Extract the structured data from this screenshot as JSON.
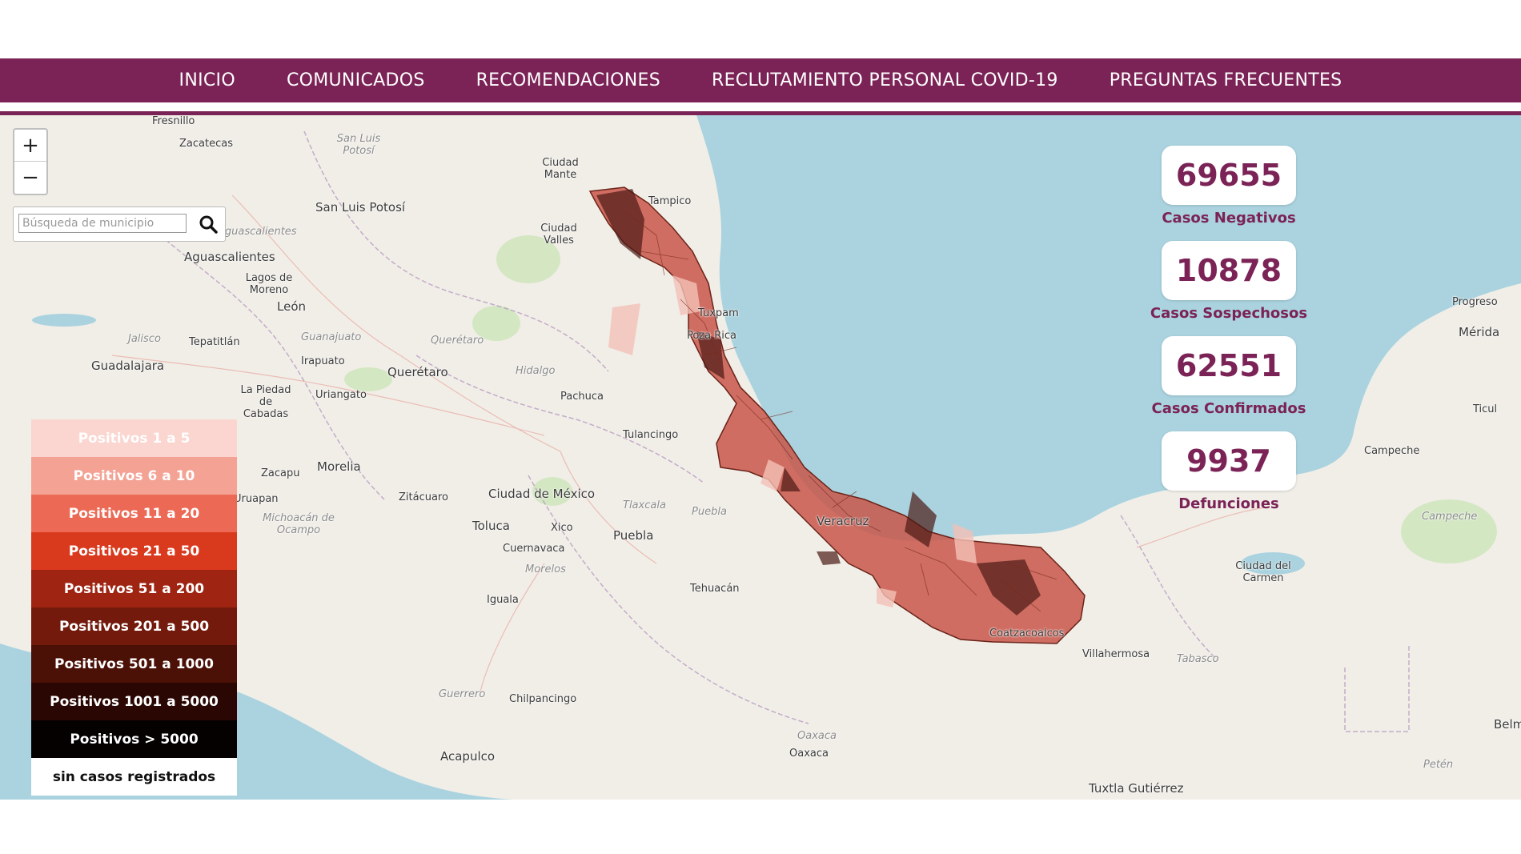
{
  "nav": {
    "items": [
      {
        "label": "INICIO"
      },
      {
        "label": "COMUNICADOS"
      },
      {
        "label": "RECOMENDACIONES"
      },
      {
        "label": "RECLUTAMIENTO PERSONAL COVID-19"
      },
      {
        "label": "PREGUNTAS FRECUENTES"
      }
    ]
  },
  "colors": {
    "brand": "#7b2356",
    "water": "#aad3df",
    "land": "#f1eee8"
  },
  "map": {
    "zoom_in": "+",
    "zoom_out": "−",
    "search_placeholder": "Búsqueda de municipio",
    "search_icon": "search-icon",
    "places": {
      "fresnillo": "Fresnillo",
      "zacatecas": "Zacatecas",
      "san_luis_potosi_state": "San Luis Potosí",
      "san_luis_potosi": "San Luis Potosí",
      "ciudad_mante": "Ciudad Mante",
      "tampico": "Tampico",
      "aguascalientes_state": "Aguascalientes",
      "aguascalientes": "Aguascalientes",
      "ciudad_valles": "Ciudad Valles",
      "lagos_de_moreno": "Lagos de Moreno",
      "leon": "León",
      "jalisco": "Jalisco",
      "tepatitlan": "Tepatitlán",
      "guanajuato": "Guanajuato",
      "queretaro_state": "Querétaro",
      "irapuato": "Irapuato",
      "guadalajara": "Guadalajara",
      "queretaro": "Querétaro",
      "hidalgo": "Hidalgo",
      "uriangato": "Uriangato",
      "pachuca": "Pachuca",
      "la_piedad": "La Piedad de Cabadas",
      "tulancingo": "Tulancingo",
      "morelia": "Morelia",
      "zacapu": "Zacapu",
      "uruapan": "Uruapan",
      "zitacuaro": "Zitácuaro",
      "ciudad_de_mexico": "Ciudad de México",
      "tlaxcala": "Tlaxcala",
      "michoacan": "Michoacán de Ocampo",
      "toluca": "Toluca",
      "xico": "Xico",
      "puebla": "Puebla",
      "puebla_state": "Puebla",
      "cuernavaca": "Cuernavaca",
      "morelos": "Morelos",
      "tehuacan": "Tehuacán",
      "iguala": "Iguala",
      "guerrero": "Guerrero",
      "chilpancingo": "Chilpancingo",
      "oaxaca_state": "Oaxaca",
      "oaxaca": "Oaxaca",
      "acapulco": "Acapulco",
      "veracruz": "Veracruz",
      "poza_rica": "Poza Rica",
      "tuxpam": "Tuxpam",
      "coatzacoalcos": "Coatzacoalcos",
      "villahermosa": "Villahermosa",
      "tabasco": "Tabasco",
      "ciudad_del_carmen": "Ciudad del Carmen",
      "campeche_city": "Campeche",
      "campeche_state": "Campeche",
      "progreso": "Progreso",
      "merida": "Mérida",
      "ticul": "Ticul",
      "tuxtla": "Tuxtla Gutiérrez",
      "peten": "Petén",
      "belmopan": "Belm"
    }
  },
  "legend": [
    {
      "label": "Positivos 1 a 5",
      "color": "#fbd5cf",
      "text_color": "#ffffff"
    },
    {
      "label": "Positivos 6 a 10",
      "color": "#f3a294",
      "text_color": "#ffffff"
    },
    {
      "label": "Positivos 11 a 20",
      "color": "#ec6a55",
      "text_color": "#ffffff"
    },
    {
      "label": "Positivos 21 a 50",
      "color": "#d9391d",
      "text_color": "#ffffff"
    },
    {
      "label": "Positivos 51 a 200",
      "color": "#9f2412",
      "text_color": "#ffffff"
    },
    {
      "label": "Positivos 201 a 500",
      "color": "#731a0c",
      "text_color": "#ffffff"
    },
    {
      "label": "Positivos 501 a 1000",
      "color": "#4b1006",
      "text_color": "#ffffff"
    },
    {
      "label": "Positivos 1001 a 5000",
      "color": "#2a0702",
      "text_color": "#ffffff"
    },
    {
      "label": "Positivos > 5000",
      "color": "#050101",
      "text_color": "#ffffff"
    },
    {
      "label": "sin casos registrados",
      "color": "#ffffff",
      "text_color": "#111111"
    }
  ],
  "stats": [
    {
      "value": "69655",
      "label": "Casos Negativos"
    },
    {
      "value": "10878",
      "label": "Casos Sospechosos"
    },
    {
      "value": "62551",
      "label": "Casos Confirmados"
    },
    {
      "value": "9937",
      "label": "Defunciones"
    }
  ]
}
